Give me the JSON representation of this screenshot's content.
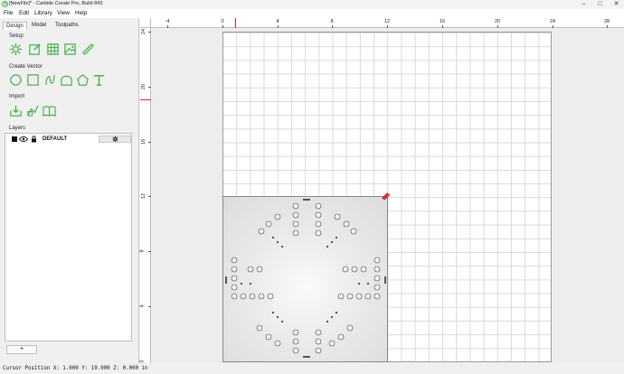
{
  "window": {
    "title": "[NewFile]* - Carbide Create Pro, Build 843",
    "controls": {
      "minimize": "–",
      "maximize": "□",
      "close": "✕"
    }
  },
  "menu": {
    "items": [
      "File",
      "Edit",
      "Library",
      "View",
      "Help"
    ]
  },
  "panel": {
    "tabs": [
      "Design",
      "Model",
      "Toolpaths"
    ],
    "active_tab": "Design",
    "sections": {
      "setup": {
        "title": "Setup",
        "tools": [
          "gear-icon",
          "edit-square-icon",
          "grid-icon",
          "image-icon",
          "ruler-icon"
        ]
      },
      "create_vector": {
        "title": "Create Vector",
        "tools": [
          "circle-icon",
          "rectangle-icon",
          "curve-icon",
          "arch-icon",
          "pentagon-icon",
          "text-icon"
        ]
      },
      "import": {
        "title": "Import",
        "tools": [
          "import-icon",
          "import-svg-icon",
          "open-book-icon"
        ]
      },
      "layers": {
        "title": "Layers",
        "items": [
          {
            "name": "DEFAULT",
            "color": "#000000",
            "visible": true,
            "locked": false
          }
        ],
        "add_label": "+"
      }
    }
  },
  "ruler": {
    "h_labels": [
      "-4",
      "0",
      "4",
      "8",
      "12",
      "16",
      "20",
      "24",
      "28"
    ],
    "v_labels": [
      "24",
      "20",
      "16",
      "12",
      "8",
      "4",
      "0"
    ]
  },
  "status": {
    "text": "Cursor Position X: 1.000 Y: 19.000 Z: 0.000 in"
  },
  "colors": {
    "accent": "#3cab3c",
    "cursor_marker": "#e02020",
    "grid_line": "#d9d9d9"
  }
}
